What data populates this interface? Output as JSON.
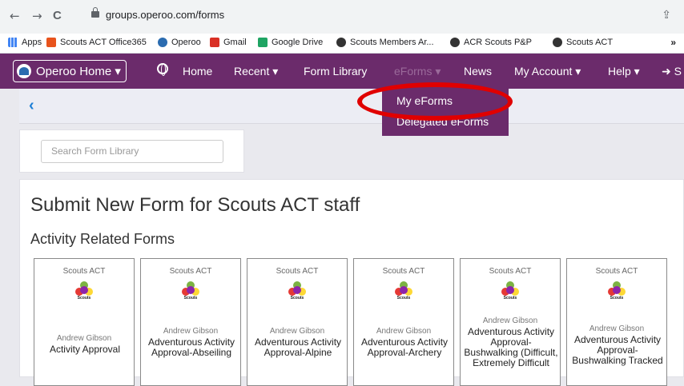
{
  "browser": {
    "back": "←",
    "forward": "→",
    "reload": "C",
    "url": "groups.operoo.com/forms",
    "share": "⇪"
  },
  "bookmarks": [
    {
      "label": "Apps",
      "color": "#4285f4"
    },
    {
      "label": "Scouts ACT Office365",
      "color": "#e8531c"
    },
    {
      "label": "Operoo",
      "color": "#2b6cb0"
    },
    {
      "label": "Gmail",
      "color": "#d93025"
    },
    {
      "label": "Google Drive",
      "color": "#1fa463"
    },
    {
      "label": "Scouts Members Ar...",
      "color": "#333333"
    },
    {
      "label": "ACR Scouts P&P",
      "color": "#333333"
    },
    {
      "label": "Scouts ACT",
      "color": "#333333"
    }
  ],
  "bookmarks_more": "»",
  "nav": {
    "home_button": "Operoo Home ▾",
    "home": "Home",
    "recent": "Recent ▾",
    "form_library": "Form Library",
    "eforms": "eForms ▾",
    "news": "News",
    "my_account": "My Account ▾",
    "help": "Help ▾",
    "sign": "S"
  },
  "dropdown": {
    "my_eforms": "My eForms",
    "delegated": "Delegated eForms"
  },
  "search": {
    "placeholder": "Search Form Library"
  },
  "main": {
    "title": "Submit New Form for Scouts ACT staff",
    "section": "Activity Related Forms"
  },
  "cards": [
    {
      "org": "Scouts ACT",
      "logo_text": "Scouts",
      "author": "Andrew Gibson",
      "name": "Activity Approval"
    },
    {
      "org": "Scouts ACT",
      "logo_text": "Scouts",
      "author": "Andrew Gibson",
      "name": "Adventurous Activity Approval-Abseiling"
    },
    {
      "org": "Scouts ACT",
      "logo_text": "Scouts",
      "author": "Andrew Gibson",
      "name": "Adventurous Activity Approval-Alpine"
    },
    {
      "org": "Scouts ACT",
      "logo_text": "Scouts",
      "author": "Andrew Gibson",
      "name": "Adventurous Activity Approval-Archery"
    },
    {
      "org": "Scouts ACT",
      "logo_text": "Scouts",
      "author": "Andrew Gibson",
      "name": "Adventurous Activity Approval-Bushwalking (Difficult, Extremely Difficult"
    },
    {
      "org": "Scouts ACT",
      "logo_text": "Scouts",
      "author": "Andrew Gibson",
      "name": "Adventurous Activity Approval-Bushwalking Tracked"
    }
  ],
  "colors": {
    "nav_purple": "#6b2b6b",
    "highlight_red": "#e00000",
    "link_blue": "#1e7fd6"
  }
}
